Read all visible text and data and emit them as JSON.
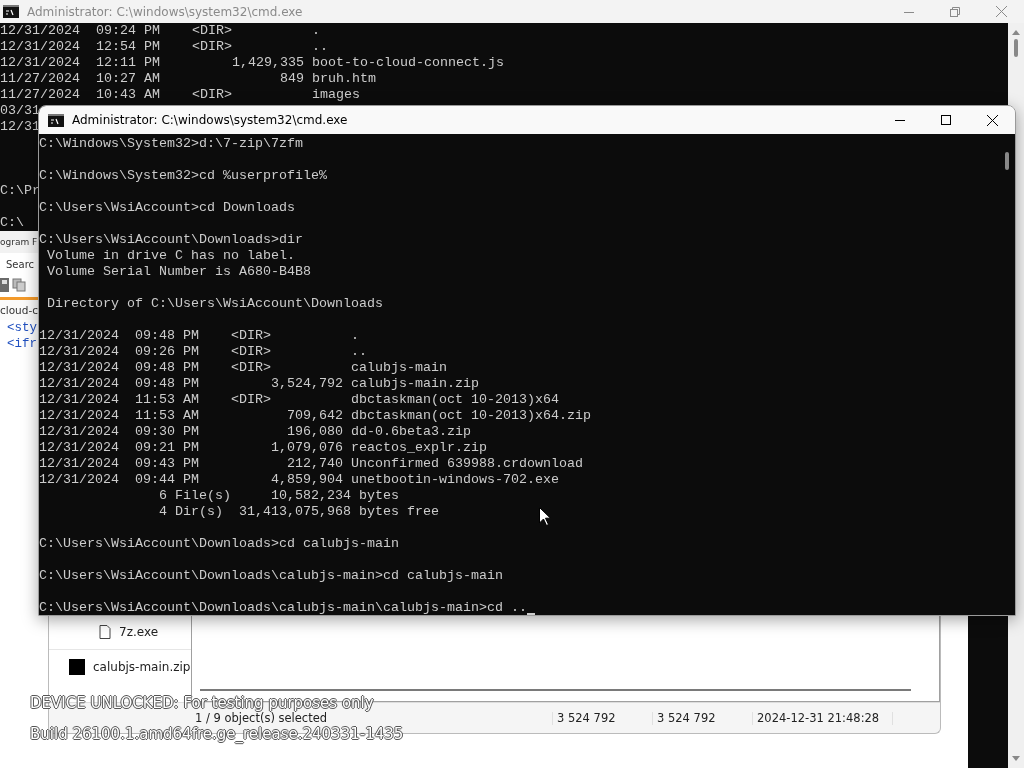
{
  "back_console": {
    "title": "Administrator: C:\\windows\\system32\\cmd.exe",
    "active": false,
    "maximized": true,
    "lines": [
      {
        "kind": "output",
        "text": "12/31/2024  09:24 PM    <DIR>          ."
      },
      {
        "kind": "output",
        "text": "12/31/2024  12:54 PM    <DIR>          .."
      },
      {
        "kind": "output",
        "text": "12/31/2024  12:11 PM         1,429,335 boot-to-cloud-connect.js"
      },
      {
        "kind": "output",
        "text": "11/27/2024  10:27 AM               849 bruh.htm"
      },
      {
        "kind": "output",
        "text": "11/27/2024  10:43 AM    <DIR>          images"
      },
      {
        "kind": "output",
        "text": "03/31"
      },
      {
        "kind": "output",
        "text": "12/31"
      },
      {
        "kind": "blank"
      },
      {
        "kind": "blank"
      },
      {
        "kind": "blank"
      },
      {
        "kind": "output",
        "text": "C:\\Pr"
      },
      {
        "kind": "blank"
      },
      {
        "kind": "output",
        "text": "C:\\"
      }
    ]
  },
  "editor": {
    "title_fragment": "ogram F",
    "menu_item": "Searc",
    "tab": "cloud-c",
    "code_lines": [
      "<sty",
      "<ifr"
    ]
  },
  "archive_manager": {
    "files": [
      {
        "name": "7z.exe",
        "kind": "file"
      },
      {
        "name": "calubjs-main.zip",
        "kind": "archive"
      }
    ],
    "status_bar": [
      "1 / 9 object(s) selected",
      "3 524 792",
      "3 524 792",
      "2024-12-31 21:48:28"
    ]
  },
  "front_console": {
    "title": "Administrator: C:\\windows\\system32\\cmd.exe",
    "active": true,
    "maximized": false,
    "lines": [
      {
        "kind": "output",
        "text": "C:\\Windows\\System32>d:\\7-zip\\7zfm"
      },
      {
        "kind": "blank"
      },
      {
        "kind": "output",
        "text": "C:\\Windows\\System32>cd %userprofile%"
      },
      {
        "kind": "blank"
      },
      {
        "kind": "output",
        "text": "C:\\Users\\WsiAccount>cd Downloads"
      },
      {
        "kind": "blank"
      },
      {
        "kind": "output",
        "text": "C:\\Users\\WsiAccount\\Downloads>dir"
      },
      {
        "kind": "output",
        "text": " Volume in drive C has no label."
      },
      {
        "kind": "output",
        "text": " Volume Serial Number is A680-B4B8"
      },
      {
        "kind": "blank"
      },
      {
        "kind": "output",
        "text": " Directory of C:\\Users\\WsiAccount\\Downloads"
      },
      {
        "kind": "blank"
      },
      {
        "kind": "output",
        "text": "12/31/2024  09:48 PM    <DIR>          ."
      },
      {
        "kind": "output",
        "text": "12/31/2024  09:26 PM    <DIR>          .."
      },
      {
        "kind": "output",
        "text": "12/31/2024  09:48 PM    <DIR>          calubjs-main"
      },
      {
        "kind": "output",
        "text": "12/31/2024  09:48 PM         3,524,792 calubjs-main.zip"
      },
      {
        "kind": "output",
        "text": "12/31/2024  11:53 AM    <DIR>          dbctaskman(oct 10-2013)x64"
      },
      {
        "kind": "output",
        "text": "12/31/2024  11:53 AM           709,642 dbctaskman(oct 10-2013)x64.zip"
      },
      {
        "kind": "output",
        "text": "12/31/2024  09:30 PM           196,080 dd-0.6beta3.zip"
      },
      {
        "kind": "output",
        "text": "12/31/2024  09:21 PM         1,079,076 reactos_explr.zip"
      },
      {
        "kind": "output",
        "text": "12/31/2024  09:43 PM           212,740 Unconfirmed 639988.crdownload"
      },
      {
        "kind": "output",
        "text": "12/31/2024  09:44 PM         4,859,904 unetbootin-windows-702.exe"
      },
      {
        "kind": "output",
        "text": "               6 File(s)     10,582,234 bytes"
      },
      {
        "kind": "output",
        "text": "               4 Dir(s)  31,413,075,968 bytes free"
      },
      {
        "kind": "blank"
      },
      {
        "kind": "output",
        "text": "C:\\Users\\WsiAccount\\Downloads>cd calubjs-main"
      },
      {
        "kind": "blank"
      },
      {
        "kind": "output",
        "text": "C:\\Users\\WsiAccount\\Downloads\\calubjs-main>cd calubjs-main"
      },
      {
        "kind": "blank"
      },
      {
        "kind": "output",
        "text": "C:\\Users\\WsiAccount\\Downloads\\calubjs-main\\calubjs-main>cd ..",
        "cursor": true
      }
    ]
  },
  "watermark": [
    "DEVICE UNLOCKED: For testing purposes only",
    "Build 26100.1.amd64fre.ge_release.240331-1435"
  ]
}
